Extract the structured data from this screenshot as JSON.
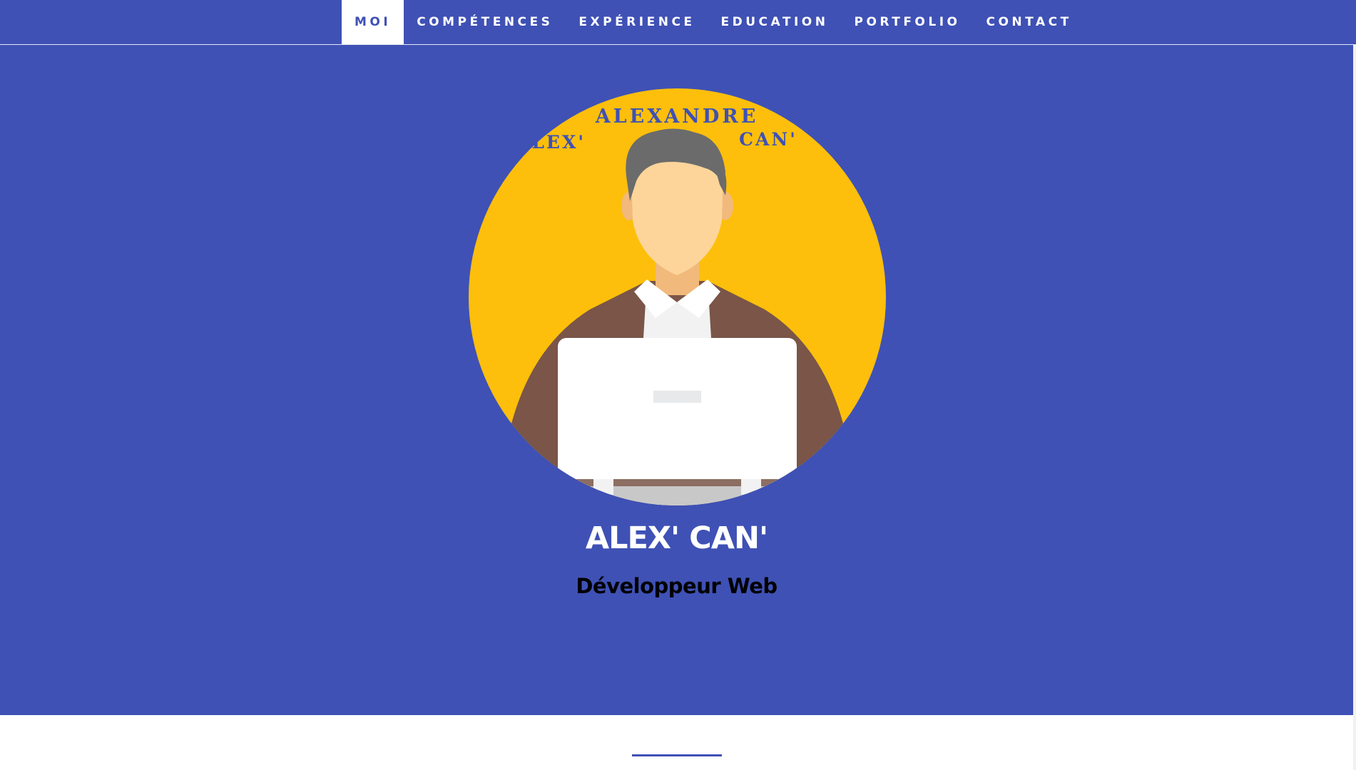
{
  "nav": {
    "items": [
      {
        "label": "MOI",
        "active": true
      },
      {
        "label": "COMPÉTENCES",
        "active": false
      },
      {
        "label": "EXPÉRIENCE",
        "active": false
      },
      {
        "label": "EDUCATION",
        "active": false
      },
      {
        "label": "PORTFOLIO",
        "active": false
      },
      {
        "label": "CONTACT",
        "active": false
      }
    ]
  },
  "hero": {
    "avatar": {
      "line1": "ALEXANDRE",
      "line2_left": "ALEX'",
      "line2_right": "CAN'"
    },
    "name": "ALEX' CAN'",
    "role": "Développeur Web"
  },
  "colors": {
    "primary": "#3f51b5",
    "avatar_background": "#fdbf0b",
    "suit": "#7a5548",
    "skin": "#fdd59a",
    "hair": "#6b6b6b",
    "laptop": "#ffffff"
  }
}
